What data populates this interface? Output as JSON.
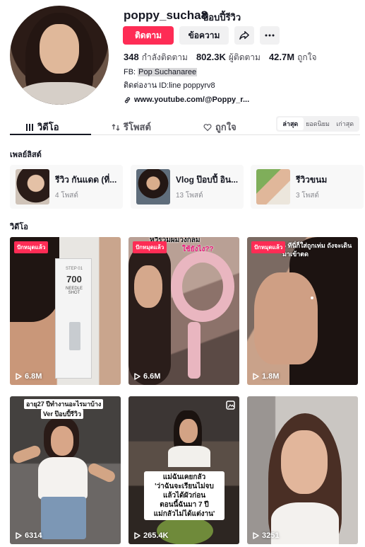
{
  "profile": {
    "username": "poppy_sucha8",
    "nickname": "ป๊อบปี้รีวิว",
    "follow_label": "ติดตาม",
    "message_label": "ข้อความ",
    "stats": {
      "following_count": "348",
      "following_label": "กำลังติดตาม",
      "followers_count": "802.3K",
      "followers_label": "ผู้ติดตาม",
      "likes_count": "42.7M",
      "likes_label": "ถูกใจ"
    },
    "bio_prefix": "FB: ",
    "bio_highlight": "Pop Suchanaree",
    "bio_line2": "ติดต่องาน ID:line poppyrv8",
    "link": "www.youtube.com/@Poppy_r..."
  },
  "tabs": [
    {
      "label": "วิดีโอ",
      "icon": "grid-icon"
    },
    {
      "label": "รีโพสต์",
      "icon": "repost-icon"
    },
    {
      "label": "ถูกใจ",
      "icon": "heart-icon"
    }
  ],
  "sort": [
    "ล่าสุด",
    "ยอดนิยม",
    "เก่าสุด"
  ],
  "playlists_title": "เพลย์ลิสต์",
  "playlists": [
    {
      "name": "รีวิว กันแดด (ที่...",
      "count": "4 โพสต์"
    },
    {
      "name": "Vlog ป๊อบปี้ อิน...",
      "count": "13 โพสต์"
    },
    {
      "name": "รีวิวขนม",
      "count": "3 โพสต์"
    }
  ],
  "videos_title": "วิดีโอ",
  "pinned_label": "ปักหมุดแล้ว",
  "videos": [
    {
      "views": "6.8M",
      "pinned": true,
      "product_step": "STEP 01",
      "product_num": "700",
      "product_name": "NEEDLE SHOT"
    },
    {
      "views": "6.6M",
      "pinned": true,
      "caption": "หวีรวมผมวงกลม",
      "subcaption": "ใช้ยังไง??"
    },
    {
      "views": "1.8M",
      "pinned": true,
      "caption": "4 ทีนี่ก็ใส่ถูกเท่ม ถังจะเดินมาเข้าตด"
    },
    {
      "views": "6314",
      "caption_line1": "อายุ27 ปีทำงานอะไรมาบ้าง",
      "caption_line2": "Ver ป๊อบปี้รีวิว"
    },
    {
      "views": "265.4K",
      "caption_lines": [
        "แม่ฉันเคยกลัว",
        "'ว่าฉันจะเรียนไม่จบ",
        "แล้วได้ผัวก่อน",
        "ตอนนี้ฉันมา 7 ปี",
        "แม่กลัวไม่ได้แต่งาน'"
      ]
    },
    {
      "views": "3251"
    }
  ],
  "colors": {
    "accent": "#fe2c55",
    "text": "#161823",
    "muted": "#8a8b91"
  }
}
